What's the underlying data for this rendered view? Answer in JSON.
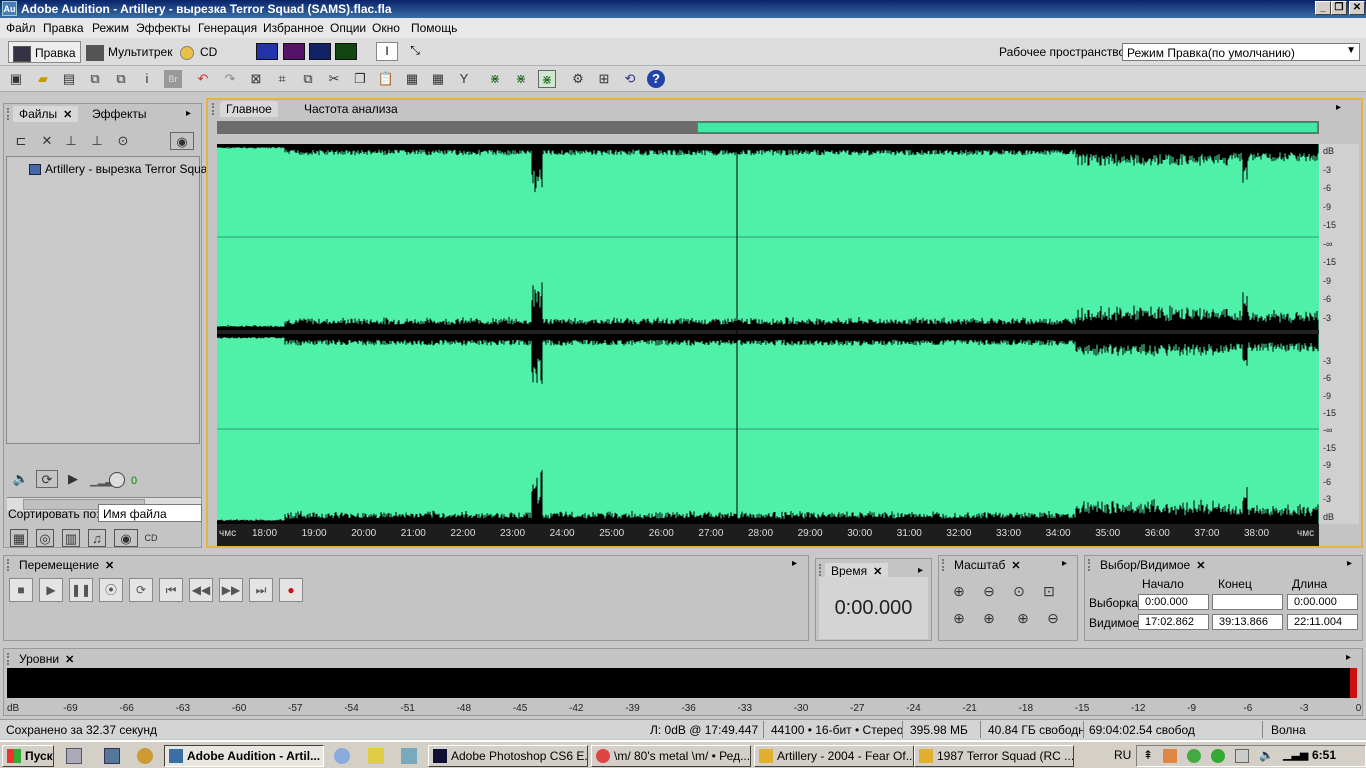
{
  "window": {
    "title": "Adobe Audition - Artillery - вырезка Terror Squad (SAMS).flac.fla",
    "app_icon": "Au"
  },
  "menu": [
    "Файл",
    "Правка",
    "Режим",
    "Эффекты",
    "Генерация",
    "Избранное",
    "Опции",
    "Окно",
    "Помощь"
  ],
  "modes": {
    "edit": "Правка",
    "multitrack": "Мультитрек",
    "cd": "CD"
  },
  "workspace": {
    "label": "Рабочее пространство:",
    "value": "Режим Правка(по умолчанию)"
  },
  "files_panel": {
    "tabs": [
      "Файлы",
      "Эффекты"
    ],
    "file_item": "Artillery - вырезка Terror Squad",
    "sort_label": "Сортировать по:",
    "sort_value": "Имя файла",
    "volume_value": "0"
  },
  "editor": {
    "tabs": [
      "Главное",
      "Частота  анализа"
    ],
    "db_labels_ch1": [
      "dB",
      "-3",
      "-6",
      "-9",
      "-15",
      "-∞",
      "-15",
      "-9",
      "-6",
      "-3"
    ],
    "db_labels_ch2": [
      "-3",
      "-6",
      "-9",
      "-15",
      "-∞",
      "-15",
      "-9",
      "-6",
      "-3",
      "dB"
    ],
    "timeline": {
      "start": "чмс",
      "end": "чмс",
      "ticks": [
        "18:00",
        "19:00",
        "20:00",
        "21:00",
        "22:00",
        "23:00",
        "24:00",
        "25:00",
        "26:00",
        "27:00",
        "28:00",
        "29:00",
        "30:00",
        "31:00",
        "32:00",
        "33:00",
        "34:00",
        "35:00",
        "36:00",
        "37:00",
        "38:00"
      ]
    },
    "overview_visible_fraction": [
      0.436,
      1.0
    ]
  },
  "transport": {
    "title": "Перемещение"
  },
  "time_panel": {
    "title": "Время",
    "value": "0:00.000"
  },
  "zoom_panel": {
    "title": "Масштаб"
  },
  "selection_panel": {
    "title": "Выбор/Видимое",
    "headers": {
      "start": "Начало",
      "end": "Конец",
      "length": "Длина"
    },
    "selection": {
      "label": "Выборка",
      "start": "0:00.000",
      "end": "",
      "length": "0:00.000"
    },
    "view": {
      "label": "Видимое",
      "start": "17:02.862",
      "end": "39:13.866",
      "length": "22:11.004"
    }
  },
  "levels": {
    "title": "Уровни",
    "scale": [
      "dB",
      "-69",
      "-66",
      "-63",
      "-60",
      "-57",
      "-54",
      "-51",
      "-48",
      "-45",
      "-42",
      "-39",
      "-36",
      "-33",
      "-30",
      "-27",
      "-24",
      "-21",
      "-18",
      "-15",
      "-12",
      "-9",
      "-6",
      "-3",
      "0"
    ]
  },
  "status": {
    "saved": "Сохранено за 32.37 секунд",
    "level": "Л: 0dB @  17:49.447",
    "format": "44100 • 16-бит • Стерео",
    "size": "395.98 МБ",
    "free": "40.84 ГБ свободн",
    "free_time": "69:04:02.54 свобод",
    "view": "Волна"
  },
  "taskbar": {
    "start": "Пуск",
    "tasks": [
      "Adobe Audition - Artil...",
      "Adobe Photoshop CS6 E...",
      "\\m/ 80's metal \\m/ • Ред...",
      "Artillery - 2004 - Fear Of...",
      "1987 Terror Squad (RC ..."
    ],
    "lang": "RU",
    "clock": "6:51"
  },
  "colors": {
    "waveform_bg": "#4ff0a8",
    "waveform_fg": "#000000",
    "panel_border_active": "#e3b24a",
    "record": "#cc1111"
  }
}
